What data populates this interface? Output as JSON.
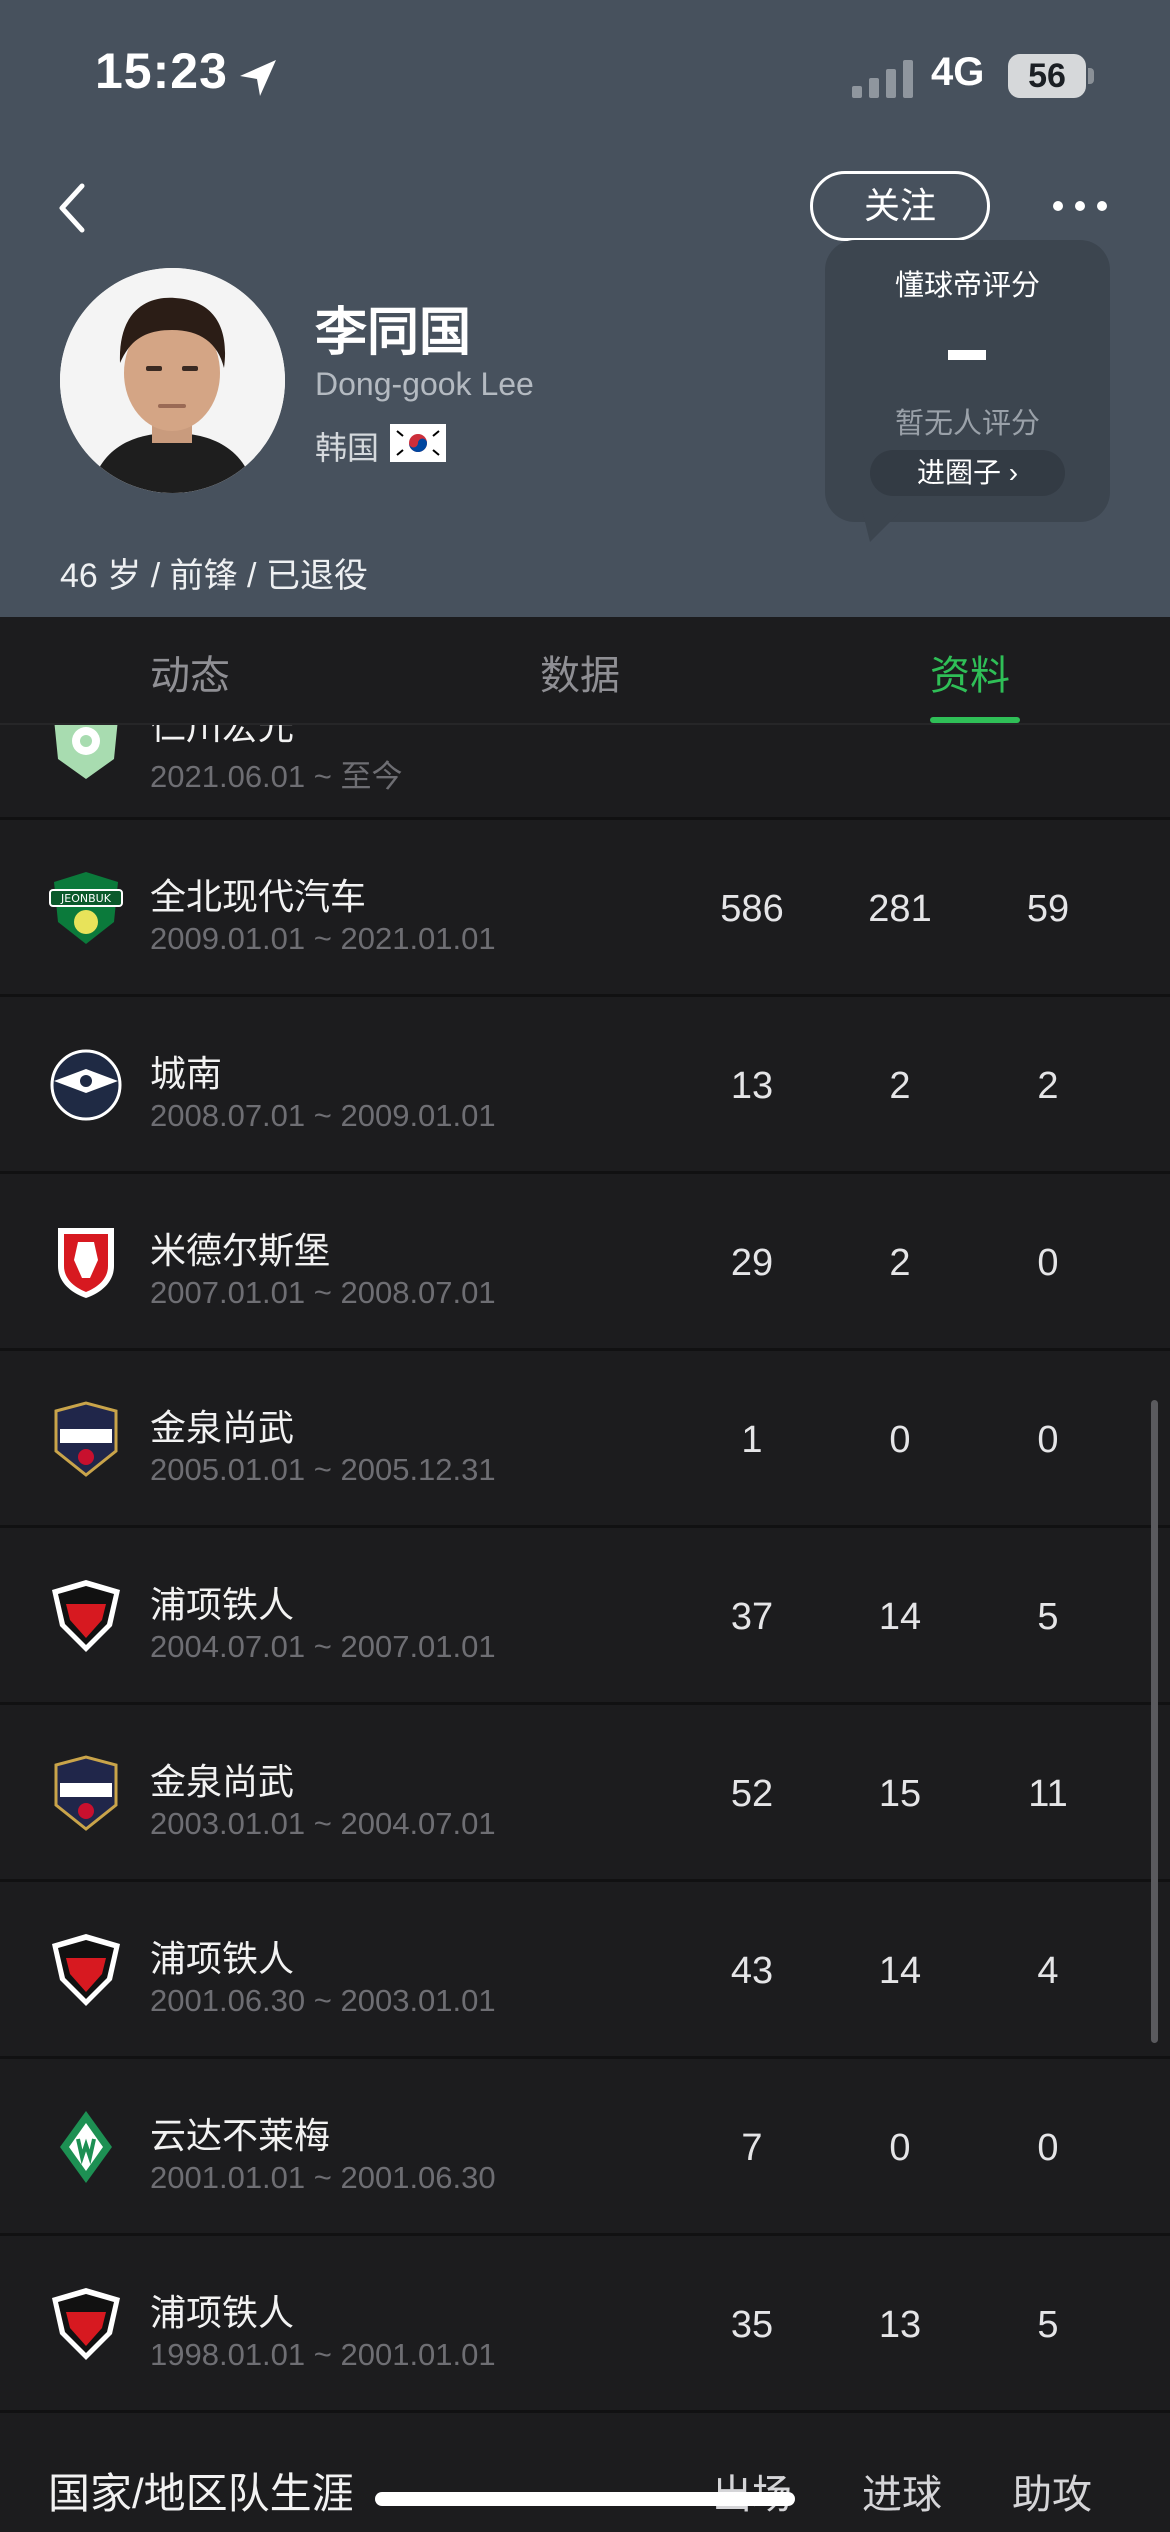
{
  "status_bar": {
    "time": "15:23",
    "network": "4G",
    "battery": "56"
  },
  "header": {
    "follow_label": "关注",
    "player": {
      "name_cn": "李同国",
      "name_en": "Dong-gook Lee",
      "country": "韩国",
      "bio": "46 岁 / 前锋 / 已退役"
    },
    "rating": {
      "title": "懂球帝评分",
      "value": "-",
      "status": "暂无人评分",
      "link": "进圈子 ›"
    }
  },
  "tabs": [
    {
      "label": "动态",
      "active": false
    },
    {
      "label": "数据",
      "active": false
    },
    {
      "label": "资料",
      "active": true
    }
  ],
  "clubs": [
    {
      "name": "仁川宏光",
      "dates": "2021.06.01 ~ 至今",
      "apps": "",
      "goals": "",
      "assists": "",
      "logo": "incheon-logo"
    },
    {
      "name": "全北现代汽车",
      "dates": "2009.01.01 ~ 2021.01.01",
      "apps": "586",
      "goals": "281",
      "assists": "59",
      "logo": "jeonbuk-logo"
    },
    {
      "name": "城南",
      "dates": "2008.07.01 ~ 2009.01.01",
      "apps": "13",
      "goals": "2",
      "assists": "2",
      "logo": "seongnam-logo"
    },
    {
      "name": "米德尔斯堡",
      "dates": "2007.01.01 ~ 2008.07.01",
      "apps": "29",
      "goals": "2",
      "assists": "0",
      "logo": "middlesbrough-logo"
    },
    {
      "name": "金泉尚武",
      "dates": "2005.01.01 ~ 2005.12.31",
      "apps": "1",
      "goals": "0",
      "assists": "0",
      "logo": "gimcheon-logo"
    },
    {
      "name": "浦项铁人",
      "dates": "2004.07.01 ~ 2007.01.01",
      "apps": "37",
      "goals": "14",
      "assists": "5",
      "logo": "pohang-logo"
    },
    {
      "name": "金泉尚武",
      "dates": "2003.01.01 ~ 2004.07.01",
      "apps": "52",
      "goals": "15",
      "assists": "11",
      "logo": "gimcheon-logo"
    },
    {
      "name": "浦项铁人",
      "dates": "2001.06.30 ~ 2003.01.01",
      "apps": "43",
      "goals": "14",
      "assists": "4",
      "logo": "pohang-logo"
    },
    {
      "name": "云达不莱梅",
      "dates": "2001.01.01 ~ 2001.06.30",
      "apps": "7",
      "goals": "0",
      "assists": "0",
      "logo": "bremen-logo"
    },
    {
      "name": "浦项铁人",
      "dates": "1998.01.01 ~ 2001.01.01",
      "apps": "35",
      "goals": "13",
      "assists": "5",
      "logo": "pohang-logo"
    }
  ],
  "footer": {
    "title": "国家/地区队生涯",
    "col_apps": "出场",
    "col_goals": "进球",
    "col_assists": "助攻"
  },
  "colors": {
    "header_bg": "#47515d",
    "accent": "#2fbf57",
    "list_bg": "#1c1c1e"
  }
}
